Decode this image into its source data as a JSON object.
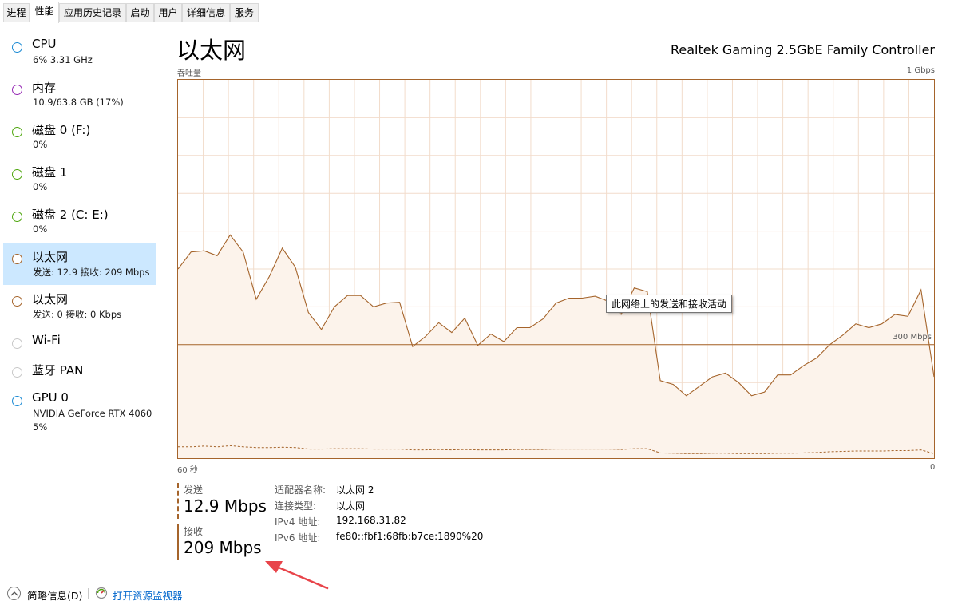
{
  "tabs": [
    {
      "label": "进程",
      "active": false
    },
    {
      "label": "性能",
      "active": true
    },
    {
      "label": "应用历史记录",
      "active": false
    },
    {
      "label": "启动",
      "active": false
    },
    {
      "label": "用户",
      "active": false
    },
    {
      "label": "详细信息",
      "active": false
    },
    {
      "label": "服务",
      "active": false
    }
  ],
  "sidebar": {
    "items": [
      {
        "name": "CPU",
        "sub": "6% 3.31 GHz",
        "dot_color": "#1a8ad4"
      },
      {
        "name": "内存",
        "sub": "10.9/63.8 GB (17%)",
        "dot_color": "#9528b4"
      },
      {
        "name": "磁盘 0 (F:)",
        "sub": "0%",
        "dot_color": "#4da60c"
      },
      {
        "name": "磁盘 1",
        "sub": "0%",
        "dot_color": "#4da60c"
      },
      {
        "name": "磁盘 2 (C: E:)",
        "sub": "0%",
        "dot_color": "#4da60c"
      },
      {
        "name": "以太网",
        "sub": "发送: 12.9 接收: 209 Mbps",
        "dot_color": "#a5642b",
        "selected": true
      },
      {
        "name": "以太网",
        "sub": "发送: 0 接收: 0 Kbps",
        "dot_color": "#a5642b"
      },
      {
        "name": "Wi-Fi",
        "sub": "",
        "dot_color": "#bbbbbb"
      },
      {
        "name": "蓝牙 PAN",
        "sub": "",
        "dot_color": "#bbbbbb"
      },
      {
        "name": "GPU 0",
        "sub": "NVIDIA GeForce RTX 4060",
        "sub2": "5%",
        "dot_color": "#1a8ad4"
      }
    ]
  },
  "main": {
    "title": "以太网",
    "device": "Realtek Gaming 2.5GbE Family Controller",
    "graph_label": "吞吐量",
    "graph_max": "1 Gbps",
    "scale_label": "300 Mbps",
    "time_left": "60 秒",
    "time_right": "0",
    "tooltip": "此网络上的发送和接收活动"
  },
  "stats": {
    "send_label": "发送",
    "send_value": "12.9 Mbps",
    "recv_label": "接收",
    "recv_value": "209 Mbps"
  },
  "info": {
    "adapter_name_label": "适配器名称:",
    "adapter_name": "以太网 2",
    "conn_type_label": "连接类型:",
    "conn_type": "以太网",
    "ipv4_label": "IPv4 地址:",
    "ipv4": "192.168.31.82",
    "ipv6_label": "IPv6 地址:",
    "ipv6": "fe80::fbf1:68fb:b7ce:1890%20"
  },
  "footer": {
    "fewer_details": "简略信息(D)",
    "open_monitor": "打开资源监视器"
  },
  "colors": {
    "accent": "#a5642b",
    "fill": "#fcf3eb",
    "grid": "#f2dccb",
    "link": "#0066cc"
  },
  "chart_data": {
    "type": "area",
    "unit": "Mbps",
    "max": 1000,
    "scale_line": 300,
    "x_seconds": [
      60,
      59,
      58,
      57,
      56,
      55,
      54,
      53,
      52,
      51,
      50,
      49,
      48,
      47,
      46,
      45,
      44,
      43,
      42,
      41,
      40,
      39,
      38,
      37,
      36,
      35,
      34,
      33,
      32,
      31,
      30,
      29,
      28,
      27,
      26,
      25,
      24,
      23,
      22,
      21,
      20,
      19,
      18,
      17,
      16,
      15,
      14,
      13,
      12,
      11,
      10,
      9,
      8,
      7,
      6,
      5,
      4,
      3,
      2,
      1,
      0
    ],
    "receive": [
      500,
      545,
      548,
      535,
      590,
      545,
      420,
      480,
      555,
      505,
      385,
      340,
      400,
      430,
      430,
      400,
      410,
      412,
      295,
      322,
      358,
      332,
      370,
      298,
      328,
      308,
      345,
      345,
      368,
      410,
      423,
      423,
      428,
      415,
      380,
      450,
      440,
      205,
      195,
      165,
      190,
      215,
      225,
      200,
      165,
      175,
      220,
      220,
      245,
      265,
      300,
      325,
      355,
      345,
      355,
      380,
      375,
      445,
      215
    ],
    "send": [
      30,
      30,
      32,
      30,
      33,
      30,
      28,
      28,
      29,
      28,
      24,
      24,
      25,
      25,
      25,
      24,
      24,
      24,
      22,
      22,
      23,
      22,
      23,
      22,
      22,
      22,
      23,
      23,
      23,
      24,
      24,
      24,
      24,
      24,
      23,
      25,
      25,
      14,
      13,
      12,
      12,
      13,
      13,
      12,
      12,
      12,
      13,
      13,
      14,
      15,
      17,
      18,
      19,
      19,
      19,
      20,
      20,
      22,
      12
    ]
  }
}
